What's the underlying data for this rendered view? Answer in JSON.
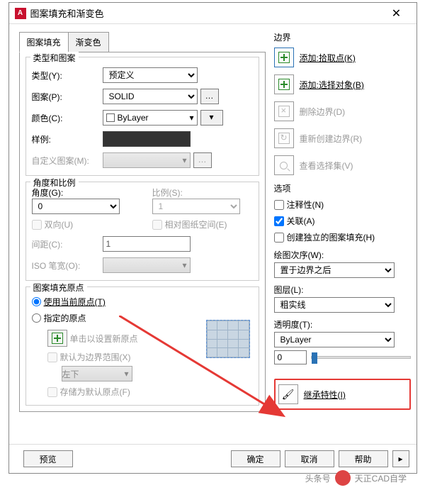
{
  "window": {
    "title": "图案填充和渐变色"
  },
  "tabs": {
    "hatch": "图案填充",
    "gradient": "渐变色"
  },
  "typePattern": {
    "group": "类型和图案",
    "typeLabel": "类型(Y):",
    "typeValue": "预定义",
    "patternLabel": "图案(P):",
    "patternValue": "SOLID",
    "colorLabel": "颜色(C):",
    "colorValue": "ByLayer",
    "sampleLabel": "样例:",
    "customLabel": "自定义图案(M):"
  },
  "angleScale": {
    "group": "角度和比例",
    "angleLabel": "角度(G):",
    "angleValue": "0",
    "scaleLabel": "比例(S):",
    "scaleValue": "1",
    "double": "双向(U)",
    "paperSpace": "相对图纸空间(E)",
    "spacingLabel": "间距(C):",
    "spacingValue": "1",
    "isoLabel": "ISO 笔宽(O):"
  },
  "origin": {
    "group": "图案填充原点",
    "useCurrent": "使用当前原点(T)",
    "specify": "指定的原点",
    "clickNew": "单击以设置新原点",
    "defaultExtent": "默认为边界范围(X)",
    "bottomLeft": "左下",
    "storeDefault": "存储为默认原点(F)"
  },
  "boundary": {
    "title": "边界",
    "pick": "添加:拾取点(K)",
    "select": "添加:选择对象(B)",
    "remove": "删除边界(D)",
    "recreate": "重新创建边界(R)",
    "view": "查看选择集(V)"
  },
  "options": {
    "title": "选项",
    "annotative": "注释性(N)",
    "associative": "关联(A)",
    "separate": "创建独立的图案填充(H)",
    "drawOrderLabel": "绘图次序(W):",
    "drawOrderValue": "置于边界之后",
    "layerLabel": "图层(L):",
    "layerValue": "粗实线",
    "transLabel": "透明度(T):",
    "transValue": "ByLayer",
    "sliderValue": "0"
  },
  "inherit": "继承特性(I)",
  "footer": {
    "preview": "预览",
    "ok": "确定",
    "cancel": "取消",
    "help": "帮助"
  },
  "watermark": {
    "src": "头条号",
    "name": "天正CAD自学"
  }
}
